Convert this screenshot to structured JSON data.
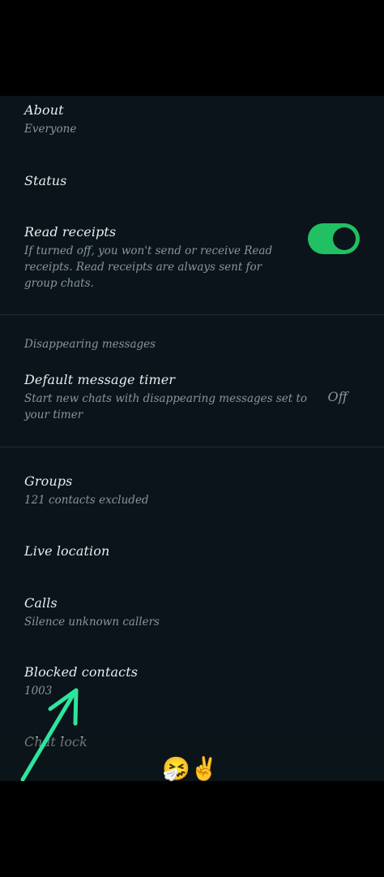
{
  "privacy": {
    "about": {
      "title": "About",
      "value": "Everyone"
    },
    "status": {
      "title": "Status"
    },
    "read_receipts": {
      "title": "Read receipts",
      "description": "If turned off, you won't send or receive Read receipts. Read receipts are always sent for group chats.",
      "enabled": true
    },
    "disappearing_section_label": "Disappearing messages",
    "default_timer": {
      "title": "Default message timer",
      "description": "Start new chats with disappearing messages set to your timer",
      "value": "Off"
    },
    "groups": {
      "title": "Groups",
      "value": "121 contacts excluded"
    },
    "live_location": {
      "title": "Live location"
    },
    "calls": {
      "title": "Calls",
      "value": "Silence unknown callers"
    },
    "blocked_contacts": {
      "title": "Blocked contacts",
      "value": "1003"
    },
    "chat_lock": {
      "title": "Chat lock"
    }
  },
  "overlay": {
    "emojis": "🤧✌️",
    "arrow_color": "#2ee59d"
  },
  "colors": {
    "background": "#0b141a",
    "accent": "#21c063",
    "primary_text": "#e9edef",
    "secondary_text": "#8696a0"
  }
}
